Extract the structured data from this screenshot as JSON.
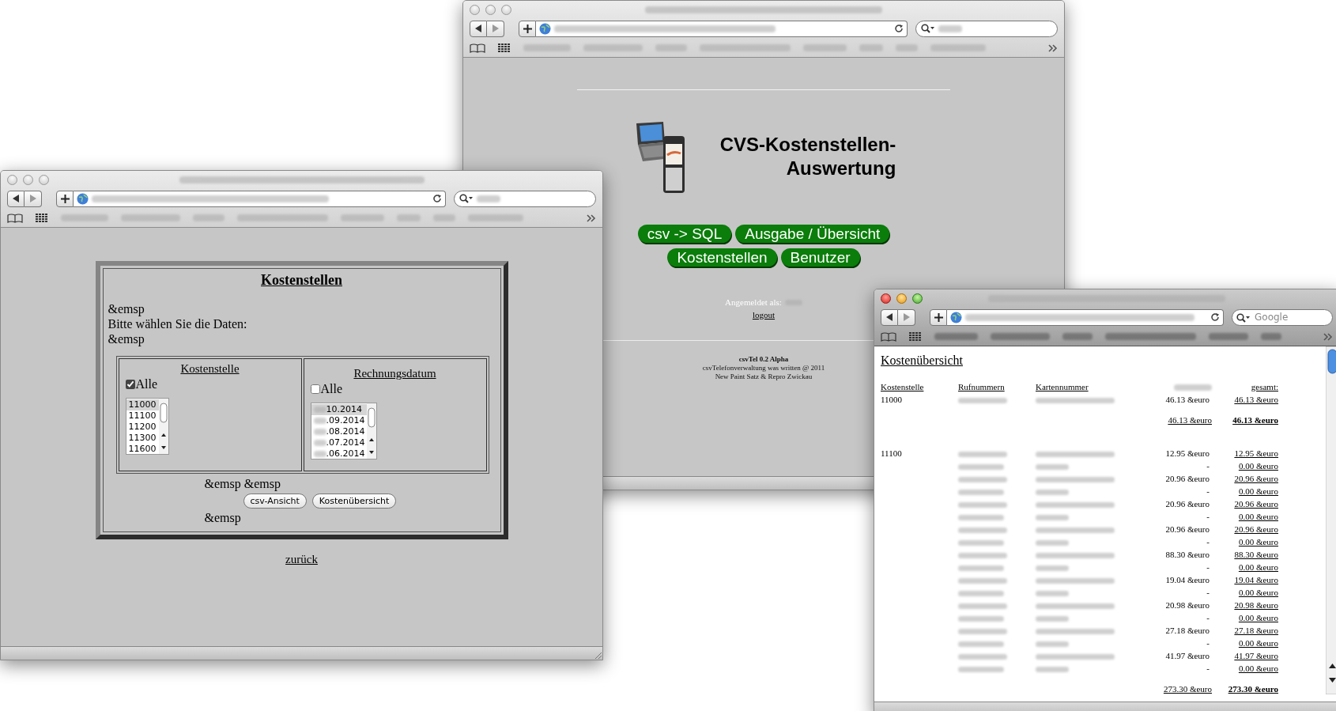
{
  "main_window": {
    "active": false,
    "title_lines": [
      "CVS-Kostenstellen-",
      "Auswertung"
    ],
    "nav_buttons": [
      [
        "csv -> SQL",
        "Ausgabe / Übersicht"
      ],
      [
        "Kostenstellen",
        "Benutzer"
      ]
    ],
    "login_label": "Angemeldet als:",
    "logout_link": "logout",
    "footer": {
      "product": "csvTel 0.2 Alpha",
      "credit": "csvTelefonverwaltung was written @ 2011",
      "company": "New Paint Satz & Repro Zwickau"
    }
  },
  "kostenstellen_window": {
    "active": false,
    "heading": "Kostenstellen",
    "intro_lines": [
      "&emsp",
      "Bitte wählen Sie die Daten:",
      "&emsp"
    ],
    "filters": [
      {
        "kind": "code",
        "label": "Kostenstelle",
        "all_label": "Alle",
        "all_checked": true,
        "options": [
          {
            "label": "11000",
            "selected": true
          },
          {
            "label": "11100",
            "selected": false
          },
          {
            "label": "11200",
            "selected": false
          },
          {
            "label": "11300",
            "selected": false
          },
          {
            "label": "11600",
            "selected": false
          }
        ]
      },
      {
        "kind": "date",
        "label": "Rechnungsdatum",
        "all_label": "Alle",
        "all_checked": false,
        "options": [
          {
            "label": "10.2014",
            "selected": true
          },
          {
            "label": ".09.2014",
            "selected": false
          },
          {
            "label": ".08.2014",
            "selected": false
          },
          {
            "label": ".07.2014",
            "selected": false
          },
          {
            "label": ".06.2014",
            "selected": false
          }
        ]
      }
    ],
    "spacer_top": "&emsp &emsp",
    "buttons": [
      "csv-Ansicht",
      "Kostenübersicht"
    ],
    "spacer_bottom": "&emsp",
    "back_link": "zurück"
  },
  "kostenuebersicht_window": {
    "active": true,
    "search": {
      "placeholder": "Google"
    },
    "heading": "Kostenübersicht",
    "columns": [
      {
        "kind": "text",
        "label": "Kostenstelle"
      },
      {
        "kind": "text",
        "label": "Rufnummern"
      },
      {
        "kind": "text",
        "label": "Kartennummer"
      },
      {
        "kind": "redacted"
      },
      {
        "kind": "text",
        "label": "gesamt:"
      }
    ],
    "groups": [
      {
        "kostenstelle": "11000",
        "rows": [
          {
            "amount": "46.13 &euro",
            "total": "46.13 &euro"
          }
        ],
        "subtotal_amount": "46.13 &euro",
        "subtotal_total": "46.13 &euro"
      },
      {
        "kostenstelle": "11100",
        "rows": [
          {
            "amount": "12.95 &euro",
            "total": "12.95 &euro"
          },
          {
            "amount": "-",
            "total": "0.00 &euro"
          },
          {
            "amount": "20.96 &euro",
            "total": "20.96 &euro"
          },
          {
            "amount": "-",
            "total": "0.00 &euro"
          },
          {
            "amount": "20.96 &euro",
            "total": "20.96 &euro"
          },
          {
            "amount": "-",
            "total": "0.00 &euro"
          },
          {
            "amount": "20.96 &euro",
            "total": "20.96 &euro"
          },
          {
            "amount": "-",
            "total": "0.00 &euro"
          },
          {
            "amount": "88.30 &euro",
            "total": "88.30 &euro"
          },
          {
            "amount": "-",
            "total": "0.00 &euro"
          },
          {
            "amount": "19.04 &euro",
            "total": "19.04 &euro"
          },
          {
            "amount": "-",
            "total": "0.00 &euro"
          },
          {
            "amount": "20.98 &euro",
            "total": "20.98 &euro"
          },
          {
            "amount": "-",
            "total": "0.00 &euro"
          },
          {
            "amount": "27.18 &euro",
            "total": "27.18 &euro"
          },
          {
            "amount": "-",
            "total": "0.00 &euro"
          },
          {
            "amount": "41.97 &euro",
            "total": "41.97 &euro"
          },
          {
            "amount": "-",
            "total": "0.00 &euro"
          }
        ],
        "subtotal_amount": "273.30 &euro",
        "subtotal_total": "273.30 &euro"
      }
    ]
  }
}
